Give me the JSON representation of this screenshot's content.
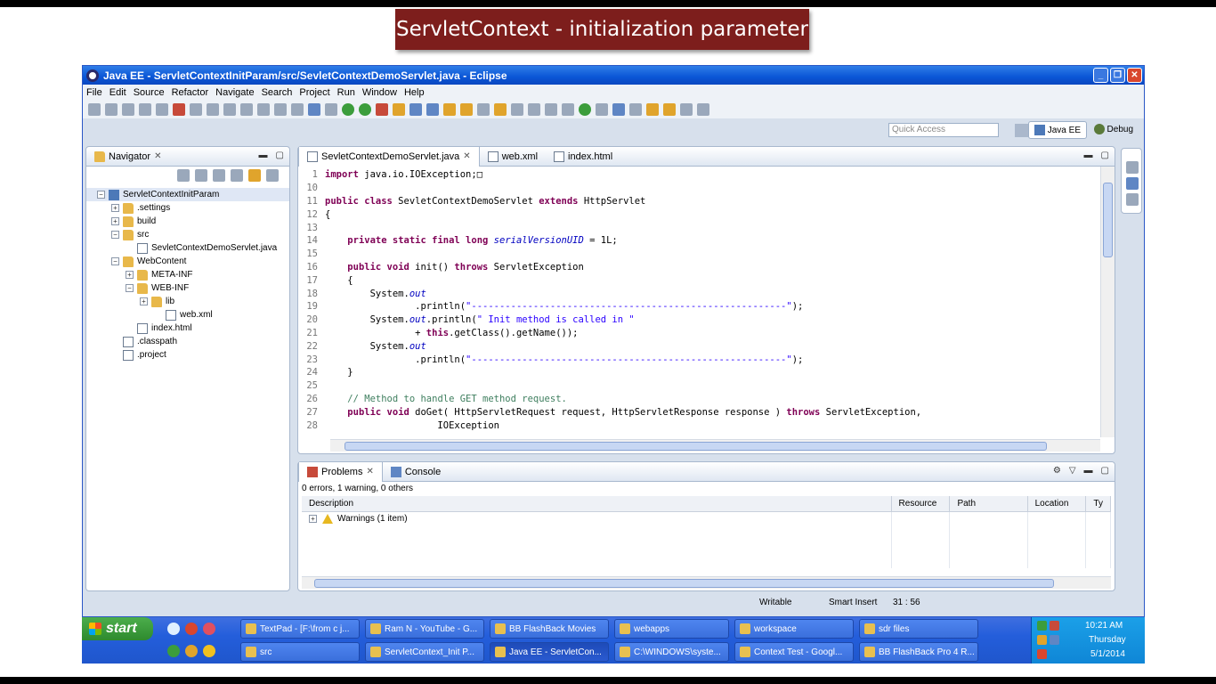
{
  "slide": {
    "title": "ServletContext - initialization parameter"
  },
  "window": {
    "title": "Java EE - ServletContextInitParam/src/SevletContextDemoServlet.java - Eclipse",
    "menu": [
      "File",
      "Edit",
      "Source",
      "Refactor",
      "Navigate",
      "Search",
      "Project",
      "Run",
      "Window",
      "Help"
    ],
    "quick_access_placeholder": "Quick Access",
    "perspectives": {
      "javaee": "Java EE",
      "debug": "Debug"
    }
  },
  "navigator": {
    "title": "Navigator",
    "tree": [
      {
        "label": "ServletContextInitParam",
        "depth": 0,
        "type": "proj",
        "exp": "minus"
      },
      {
        "label": ".settings",
        "depth": 1,
        "type": "folder",
        "exp": "plus"
      },
      {
        "label": "build",
        "depth": 1,
        "type": "folder",
        "exp": "plus"
      },
      {
        "label": "src",
        "depth": 1,
        "type": "folder",
        "exp": "minus"
      },
      {
        "label": "SevletContextDemoServlet.java",
        "depth": 2,
        "type": "java",
        "exp": "none"
      },
      {
        "label": "WebContent",
        "depth": 1,
        "type": "folder",
        "exp": "minus"
      },
      {
        "label": "META-INF",
        "depth": 2,
        "type": "folder",
        "exp": "plus"
      },
      {
        "label": "WEB-INF",
        "depth": 2,
        "type": "folder",
        "exp": "minus"
      },
      {
        "label": "lib",
        "depth": 3,
        "type": "folder",
        "exp": "plus"
      },
      {
        "label": "web.xml",
        "depth": 4,
        "type": "file",
        "exp": "none"
      },
      {
        "label": "index.html",
        "depth": 2,
        "type": "file",
        "exp": "none"
      },
      {
        "label": ".classpath",
        "depth": 1,
        "type": "file",
        "exp": "none"
      },
      {
        "label": ".project",
        "depth": 1,
        "type": "file",
        "exp": "none"
      }
    ]
  },
  "editor": {
    "tabs": [
      "SevletContextDemoServlet.java",
      "web.xml",
      "index.html"
    ],
    "lines": [
      {
        "n": "1",
        "mark": "+",
        "parts": [
          [
            "kw",
            "import"
          ],
          [
            "t",
            " java.io.IOException;"
          ],
          [
            "t",
            "□"
          ]
        ]
      },
      {
        "n": "10",
        "parts": []
      },
      {
        "n": "11",
        "parts": [
          [
            "kw",
            "public class"
          ],
          [
            "t",
            " SevletContextDemoServlet "
          ],
          [
            "kw",
            "extends"
          ],
          [
            "t",
            " HttpServlet"
          ]
        ]
      },
      {
        "n": "12",
        "parts": [
          [
            "t",
            "{"
          ]
        ]
      },
      {
        "n": "13",
        "parts": []
      },
      {
        "n": "14",
        "parts": [
          [
            "t",
            "    "
          ],
          [
            "kw",
            "private static final long"
          ],
          [
            "t",
            " "
          ],
          [
            "fld",
            "serialVersionUID"
          ],
          [
            "t",
            " = 1L;"
          ]
        ]
      },
      {
        "n": "15",
        "parts": []
      },
      {
        "n": "16",
        "mark": "-",
        "parts": [
          [
            "t",
            "    "
          ],
          [
            "kw",
            "public void"
          ],
          [
            "t",
            " init() "
          ],
          [
            "kw",
            "throws"
          ],
          [
            "t",
            " ServletException"
          ]
        ]
      },
      {
        "n": "17",
        "parts": [
          [
            "t",
            "    {"
          ]
        ]
      },
      {
        "n": "18",
        "parts": [
          [
            "t",
            "        System."
          ],
          [
            "fld",
            "out"
          ]
        ]
      },
      {
        "n": "19",
        "parts": [
          [
            "t",
            "                .println("
          ],
          [
            "str",
            "\"--------------------------------------------------------\""
          ],
          [
            "t",
            ");"
          ]
        ]
      },
      {
        "n": "20",
        "parts": [
          [
            "t",
            "        System."
          ],
          [
            "fld",
            "out"
          ],
          [
            "t",
            ".println("
          ],
          [
            "str",
            "\" Init method is called in \""
          ]
        ]
      },
      {
        "n": "21",
        "parts": [
          [
            "t",
            "                + "
          ],
          [
            "kw",
            "this"
          ],
          [
            "t",
            ".getClass().getName());"
          ]
        ]
      },
      {
        "n": "22",
        "parts": [
          [
            "t",
            "        System."
          ],
          [
            "fld",
            "out"
          ]
        ]
      },
      {
        "n": "23",
        "parts": [
          [
            "t",
            "                .println("
          ],
          [
            "str",
            "\"--------------------------------------------------------\""
          ],
          [
            "t",
            ");"
          ]
        ]
      },
      {
        "n": "24",
        "parts": [
          [
            "t",
            "    }"
          ]
        ]
      },
      {
        "n": "25",
        "parts": []
      },
      {
        "n": "26",
        "parts": [
          [
            "t",
            "    "
          ],
          [
            "cmt",
            "// Method to handle GET method request."
          ]
        ]
      },
      {
        "n": "27",
        "mark": "-",
        "parts": [
          [
            "t",
            "    "
          ],
          [
            "kw",
            "public void"
          ],
          [
            "t",
            " doGet( HttpServletRequest request, HttpServletResponse response ) "
          ],
          [
            "kw",
            "throws"
          ],
          [
            "t",
            " ServletException,"
          ]
        ]
      },
      {
        "n": "28",
        "parts": [
          [
            "t",
            "                    IOException"
          ]
        ]
      }
    ]
  },
  "problems": {
    "tabs": [
      "Problems",
      "Console"
    ],
    "summary": "0 errors, 1 warning, 0 others",
    "columns": [
      "Description",
      "Resource",
      "Path",
      "Location",
      "Ty"
    ],
    "rows": [
      [
        "Warnings (1 item)",
        "",
        "",
        "",
        ""
      ]
    ]
  },
  "status": {
    "writable": "Writable",
    "insert_mode": "Smart Insert",
    "position": "31 : 56"
  },
  "taskbar": {
    "start_label": "start",
    "row1": [
      "TextPad - [F:\\from c j...",
      "Ram N - YouTube - G...",
      "BB FlashBack Movies",
      "webapps",
      "workspace",
      "sdr files"
    ],
    "row2": [
      "src",
      "ServletContext_Init P...",
      "Java EE - ServletCon...",
      "C:\\WINDOWS\\syste...",
      "Context Test - Googl...",
      "BB FlashBack Pro 4 R..."
    ],
    "clock": {
      "time": "10:21 AM",
      "day": "Thursday",
      "date": "5/1/2014"
    }
  },
  "colors": {
    "keyword": "#7f0055",
    "string": "#2a00ff",
    "comment": "#3f7f5f",
    "field": "#0000c0",
    "slide_title_bg": "#7d1e1c"
  }
}
